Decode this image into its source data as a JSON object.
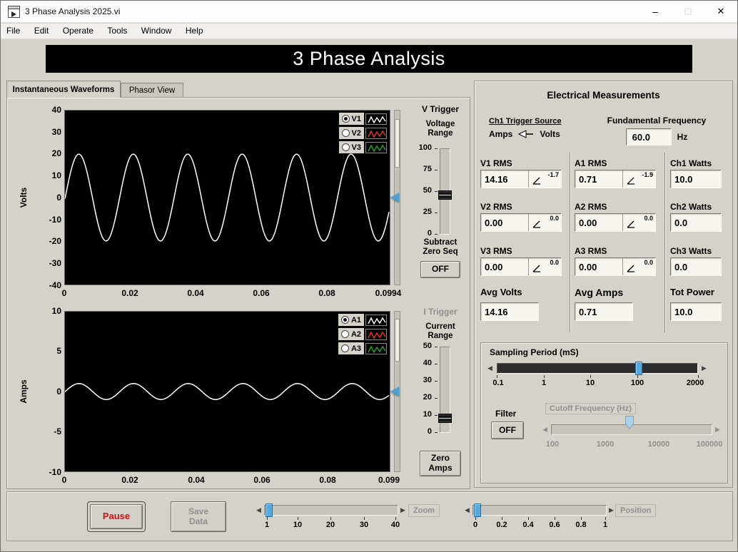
{
  "colors": {
    "panel_bg": "#d4d2ca",
    "chart_bg": "#000000",
    "accent_blue": "#58a8de",
    "pause_red": "#cf1212",
    "disabled_text": "#8f8f8f"
  },
  "window": {
    "title": "3 Phase Analysis 2025.vi",
    "minimize": "–",
    "maximize": "□",
    "close": "✕"
  },
  "menu": {
    "items": [
      "File",
      "Edit",
      "Operate",
      "Tools",
      "Window",
      "Help"
    ]
  },
  "banner": {
    "title": "3 Phase Analysis"
  },
  "tabs": {
    "tab1": "Instantaneous Waveforms",
    "tab2": "Phasor View"
  },
  "chart_data": [
    {
      "type": "line",
      "ylabel": "Volts",
      "ylim": [
        -40,
        40
      ],
      "yticks": [
        "40",
        "30",
        "20",
        "10",
        "0",
        "-10",
        "-20",
        "-30",
        "-40"
      ],
      "xlim": [
        0,
        0.0994
      ],
      "xticks": [
        "0",
        "0.02",
        "0.04",
        "0.06",
        "0.08",
        "0.0994"
      ],
      "grid": false,
      "legend_position": "top-right",
      "series": [
        {
          "name": "V1",
          "color": "#ffffff",
          "selected": true,
          "wave": {
            "amplitude": 20,
            "frequency": 60,
            "phase_deg": -1.7
          }
        },
        {
          "name": "V2",
          "color": "#e8342a",
          "selected": false,
          "wave": {
            "amplitude": 0,
            "frequency": 60,
            "phase_deg": 0
          }
        },
        {
          "name": "V3",
          "color": "#2aa52a",
          "selected": false,
          "wave": {
            "amplitude": 0,
            "frequency": 60,
            "phase_deg": 0
          }
        }
      ]
    },
    {
      "type": "line",
      "ylabel": "Amps",
      "ylim": [
        -10,
        10
      ],
      "yticks": [
        "10",
        "5",
        "0",
        "-5",
        "-10"
      ],
      "xlim": [
        0,
        0.099
      ],
      "xticks": [
        "0",
        "0.02",
        "0.04",
        "0.06",
        "0.08",
        "0.099"
      ],
      "grid": false,
      "legend_position": "top-right",
      "series": [
        {
          "name": "A1",
          "color": "#ffffff",
          "selected": true,
          "wave": {
            "amplitude": 1.0,
            "frequency": 60,
            "phase_deg": -1.9
          }
        },
        {
          "name": "A2",
          "color": "#e8342a",
          "selected": false,
          "wave": {
            "amplitude": 0,
            "frequency": 60,
            "phase_deg": 0
          }
        },
        {
          "name": "A3",
          "color": "#2aa52a",
          "selected": false,
          "wave": {
            "amplitude": 0,
            "frequency": 60,
            "phase_deg": 0
          }
        }
      ]
    }
  ],
  "v_trigger": {
    "title": "V Trigger",
    "range_label": "Voltage Range",
    "scale": [
      "100",
      "75",
      "50",
      "25",
      "0"
    ],
    "min": 0,
    "max": 100,
    "value": 45,
    "subtract_label": "Subtract Zero Seq",
    "button": "OFF"
  },
  "i_trigger": {
    "title": "I Trigger",
    "range_label": "Current Range",
    "scale": [
      "50",
      "40",
      "30",
      "20",
      "10",
      "0"
    ],
    "min": 0,
    "max": 50,
    "value": 8,
    "button": "Zero Amps"
  },
  "measurements": {
    "title": "Electrical Measurements",
    "trigger_source": {
      "label": "Ch1 Trigger Source",
      "left": "Amps",
      "right": "Volts",
      "selected": "Volts"
    },
    "fundamental": {
      "label": "Fundamental Frequency",
      "value": "60.0",
      "unit": "Hz"
    },
    "columns": {
      "volts": {
        "rows": [
          {
            "label": "V1 RMS",
            "value": "14.16",
            "angle": "-1.7"
          },
          {
            "label": "V2 RMS",
            "value": "0.00",
            "angle": "0.0"
          },
          {
            "label": "V3 RMS",
            "value": "0.00",
            "angle": "0.0"
          }
        ],
        "avg": {
          "label": "Avg Volts",
          "value": "14.16"
        }
      },
      "amps": {
        "rows": [
          {
            "label": "A1 RMS",
            "value": "0.71",
            "angle": "-1.9"
          },
          {
            "label": "A2 RMS",
            "value": "0.00",
            "angle": "0.0"
          },
          {
            "label": "A3 RMS",
            "value": "0.00",
            "angle": "0.0"
          }
        ],
        "avg": {
          "label": "Avg Amps",
          "value": "0.71"
        }
      },
      "watts": {
        "rows": [
          {
            "label": "Ch1 Watts",
            "value": "10.0"
          },
          {
            "label": "Ch2 Watts",
            "value": "0.0"
          },
          {
            "label": "Ch3 Watts",
            "value": "0.0"
          }
        ],
        "avg": {
          "label": "Tot Power",
          "value": "10.0"
        }
      }
    }
  },
  "sampling": {
    "label": "Sampling Period (mS)",
    "scale": [
      "0.1",
      "1",
      "10",
      "100",
      "2000"
    ],
    "value": 100,
    "filter_label": "Filter",
    "filter_button": "OFF",
    "cutoff": {
      "label": "Cutoff Frequency (Hz)",
      "scale": [
        "100",
        "1000",
        "10000",
        "100000"
      ],
      "disabled": true
    }
  },
  "bottom": {
    "pause_button": "Pause",
    "save_button": "Save Data",
    "zoom": {
      "label": "Zoom",
      "scale": [
        "1",
        "10",
        "20",
        "30",
        "40"
      ],
      "value": 1
    },
    "position": {
      "label": "Position",
      "scale": [
        "0",
        "0.2",
        "0.4",
        "0.6",
        "0.8",
        "1"
      ],
      "value": 0
    }
  }
}
